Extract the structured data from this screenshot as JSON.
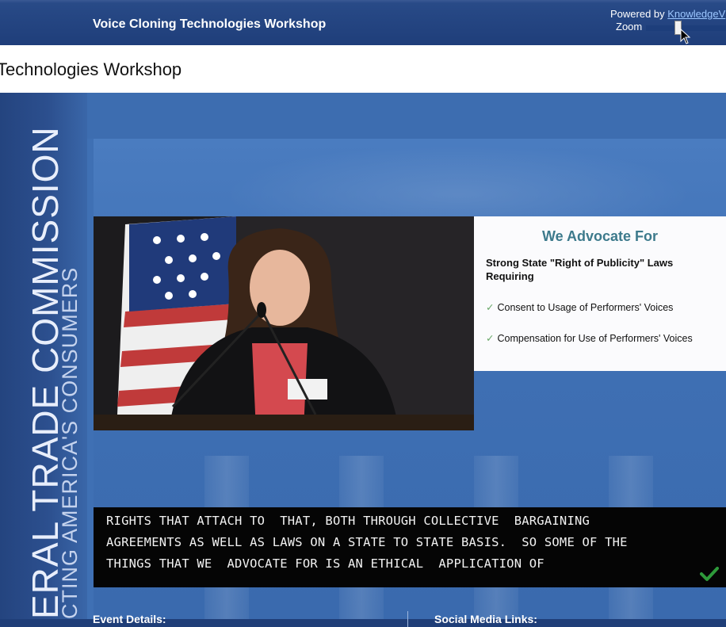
{
  "window": {
    "page_title": "Technologies Workshop"
  },
  "player": {
    "event_title": "Voice Cloning Technologies Workshop",
    "powered_by_prefix": "Powered by ",
    "powered_by_link": "KnowledgeV",
    "zoom_label": "Zoom",
    "zoom_level": 0.36
  },
  "sidebar_brand": {
    "line1": "ERAL TRADE COMMISSION",
    "line2": "CTING AMERICA'S CONSUMERS"
  },
  "slide": {
    "title": "We Advocate For",
    "subtitle": "Strong State \"Right of Publicity\" Laws Requiring",
    "items": [
      "Consent to Usage of Performers' Voices",
      "Compensation for Use of Performers' Voices"
    ]
  },
  "captions": {
    "lines": [
      "RIGHTS THAT ATTACH TO  THAT, BOTH THROUGH COLLECTIVE  BARGAINING",
      "AGREEMENTS AS WELL AS LAWS ON A STATE TO STATE BASIS.  SO SOME OF THE",
      "THINGS THAT WE  ADVOCATE FOR IS AN ETHICAL  APPLICATION OF"
    ]
  },
  "footer": {
    "event_details": "Event Details:",
    "social_media": "Social Media Links:"
  },
  "icons": {
    "cursor": "mouse-pointer-icon",
    "check": "checkmark-icon"
  },
  "colors": {
    "stage_blue": "#3f70b4",
    "slide_title_teal": "#3d7a8c",
    "check_green": "#2e9a3a",
    "link_blue": "#9cc7ff"
  }
}
